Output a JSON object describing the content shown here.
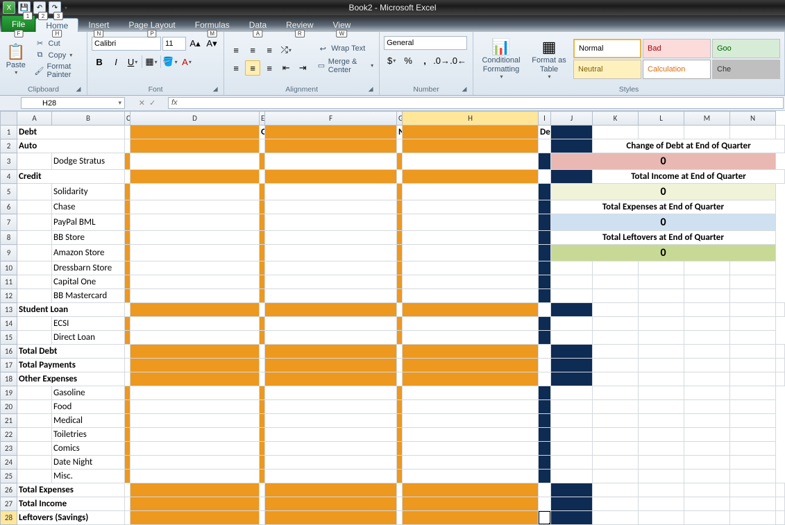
{
  "app": {
    "title": "Book2 - Microsoft Excel",
    "qat_steps": [
      "1",
      "2",
      "3"
    ]
  },
  "tabs": {
    "file": "File",
    "items": [
      {
        "label": "Home",
        "key": "H",
        "active": true
      },
      {
        "label": "Insert",
        "key": "N"
      },
      {
        "label": "Page Layout",
        "key": "P"
      },
      {
        "label": "Formulas",
        "key": "M"
      },
      {
        "label": "Data",
        "key": "A"
      },
      {
        "label": "Review",
        "key": "R"
      },
      {
        "label": "View",
        "key": "W"
      }
    ],
    "file_key": "F"
  },
  "ribbon": {
    "clipboard": {
      "paste": "Paste",
      "cut": "Cut",
      "copy": "Copy",
      "format_painter": "Format Painter",
      "label": "Clipboard"
    },
    "font": {
      "name": "Calibri",
      "size": "11",
      "label": "Font"
    },
    "alignment": {
      "wrap": "Wrap Text",
      "merge": "Merge & Center",
      "label": "Alignment"
    },
    "number": {
      "format": "General",
      "label": "Number"
    },
    "styles": {
      "cond": "Conditional Formatting",
      "table": "Format as Table",
      "cells": [
        "Normal",
        "Bad",
        "Goo",
        "Neutral",
        "Calculation",
        "Che"
      ],
      "label": "Styles"
    }
  },
  "namebox": "H28",
  "sheet": {
    "cols": [
      "A",
      "B",
      "C",
      "D",
      "E",
      "F",
      "G",
      "H",
      "I",
      "J",
      "K",
      "L",
      "M",
      "N"
    ],
    "months": {
      "D": "October",
      "F": "November",
      "H": "December"
    },
    "rows": [
      {
        "n": 1,
        "A": "Debt",
        "b": true
      },
      {
        "n": 2,
        "A": "Auto",
        "b": true
      },
      {
        "n": 3,
        "B": "Dodge Stratus"
      },
      {
        "n": 4,
        "A": "Credit",
        "b": true
      },
      {
        "n": 5,
        "B": "Solidarity"
      },
      {
        "n": 6,
        "B": "Chase"
      },
      {
        "n": 7,
        "B": "PayPal BML"
      },
      {
        "n": 8,
        "B": "BB Store"
      },
      {
        "n": 9,
        "B": "Amazon Store"
      },
      {
        "n": 10,
        "B": "Dressbarn Store"
      },
      {
        "n": 11,
        "B": "Capital One"
      },
      {
        "n": 12,
        "B": "BB Mastercard"
      },
      {
        "n": 13,
        "A": "Student Loan",
        "b": true
      },
      {
        "n": 14,
        "B": "ECSI"
      },
      {
        "n": 15,
        "B": "Direct Loan"
      },
      {
        "n": 16,
        "A": "Total Debt",
        "b": true
      },
      {
        "n": 17,
        "A": "Total Payments",
        "b": true
      },
      {
        "n": 18,
        "A": "Other Expenses",
        "b": true
      },
      {
        "n": 19,
        "B": "Gasoline"
      },
      {
        "n": 20,
        "B": "Food"
      },
      {
        "n": 21,
        "B": "Medical"
      },
      {
        "n": 22,
        "B": "Toiletries"
      },
      {
        "n": 23,
        "B": "Comics"
      },
      {
        "n": 24,
        "B": "Date Night"
      },
      {
        "n": 25,
        "B": "Misc."
      },
      {
        "n": 26,
        "A": "Total Expenses",
        "b": true
      },
      {
        "n": 27,
        "A": "Total Income",
        "b": true
      },
      {
        "n": 28,
        "A": "Leftovers (Savings)",
        "b": true
      }
    ],
    "summary": [
      {
        "title": "Change of Debt at End of Quarter",
        "value": "0",
        "cls": "summary-red"
      },
      {
        "title": "Total Income at End of Quarter",
        "value": "0",
        "cls": "summary-yel"
      },
      {
        "title": "Total Expenses at End of Quarter",
        "value": "0",
        "cls": "summary-blue"
      },
      {
        "title": "Total Leftovers at End of Quarter",
        "value": "0",
        "cls": "summary-green"
      }
    ],
    "active": {
      "row": 28,
      "col": "H"
    }
  }
}
